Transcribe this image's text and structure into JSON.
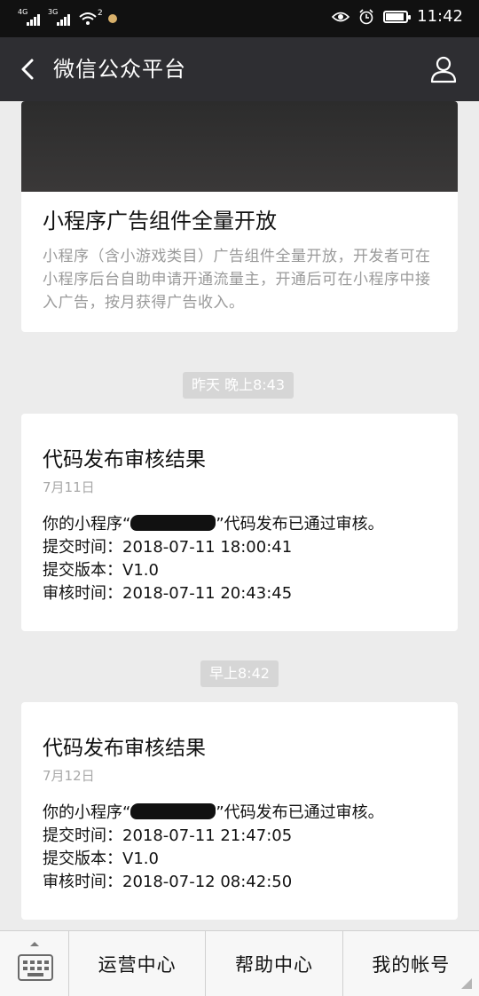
{
  "status_bar": {
    "signal1_label": "4G",
    "signal2_label": "3G",
    "wifi_badge": "2",
    "time": "11:42"
  },
  "nav": {
    "title": "微信公众平台"
  },
  "article_card": {
    "title": "小程序广告组件全量开放",
    "description": "小程序（含小游戏类目）广告组件全量开放，开发者可在小程序后台自助申请开通流量主，开通后可在小程序中接入广告，按月获得广告收入。"
  },
  "messages": [
    {
      "time_label": "昨天 晚上8:43",
      "title": "代码发布审核结果",
      "date": "7月11日",
      "line1_prefix": "你的小程序“",
      "line1_suffix": "”代码发布已通过审核。",
      "submit_time": "提交时间：2018-07-11 18:00:41",
      "version": "提交版本：V1.0",
      "review_time": "审核时间：2018-07-11 20:43:45"
    },
    {
      "time_label": "早上8:42",
      "title": "代码发布审核结果",
      "date": "7月12日",
      "line1_prefix": "你的小程序“",
      "line1_suffix": "”代码发布已通过审核。",
      "submit_time": "提交时间：2018-07-11 21:47:05",
      "version": "提交版本：V1.0",
      "review_time": "审核时间：2018-07-12 08:42:50"
    }
  ],
  "bottom_menu": {
    "items": [
      "运营中心",
      "帮助中心",
      "我的帐号"
    ]
  },
  "colors": {
    "nav_bg": "#2e2e32",
    "page_bg": "#ececec",
    "status_bg": "#111111"
  }
}
